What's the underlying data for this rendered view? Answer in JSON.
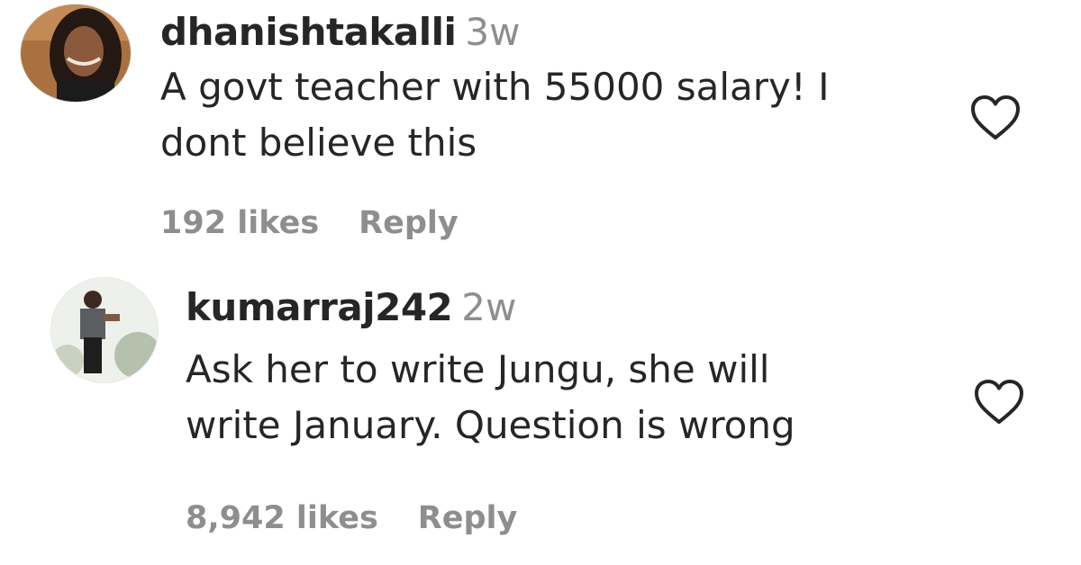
{
  "comments": [
    {
      "username": "dhanishtakalli",
      "age": "3w",
      "text_line1": "A govt teacher with 55000 salary! I",
      "text_line2": "dont believe this",
      "likes": "192 likes",
      "reply_label": "Reply"
    },
    {
      "username": "kumarraj242",
      "age": "2w",
      "text_line1": "Ask her to write Jungu, she will",
      "text_line2": "write January. Question is wrong",
      "likes": "8,942 likes",
      "reply_label": "Reply"
    }
  ],
  "icons": {
    "like": "heart-outline-icon"
  },
  "colors": {
    "text": "#262626",
    "secondary": "#8e8e8e",
    "background": "#ffffff"
  }
}
